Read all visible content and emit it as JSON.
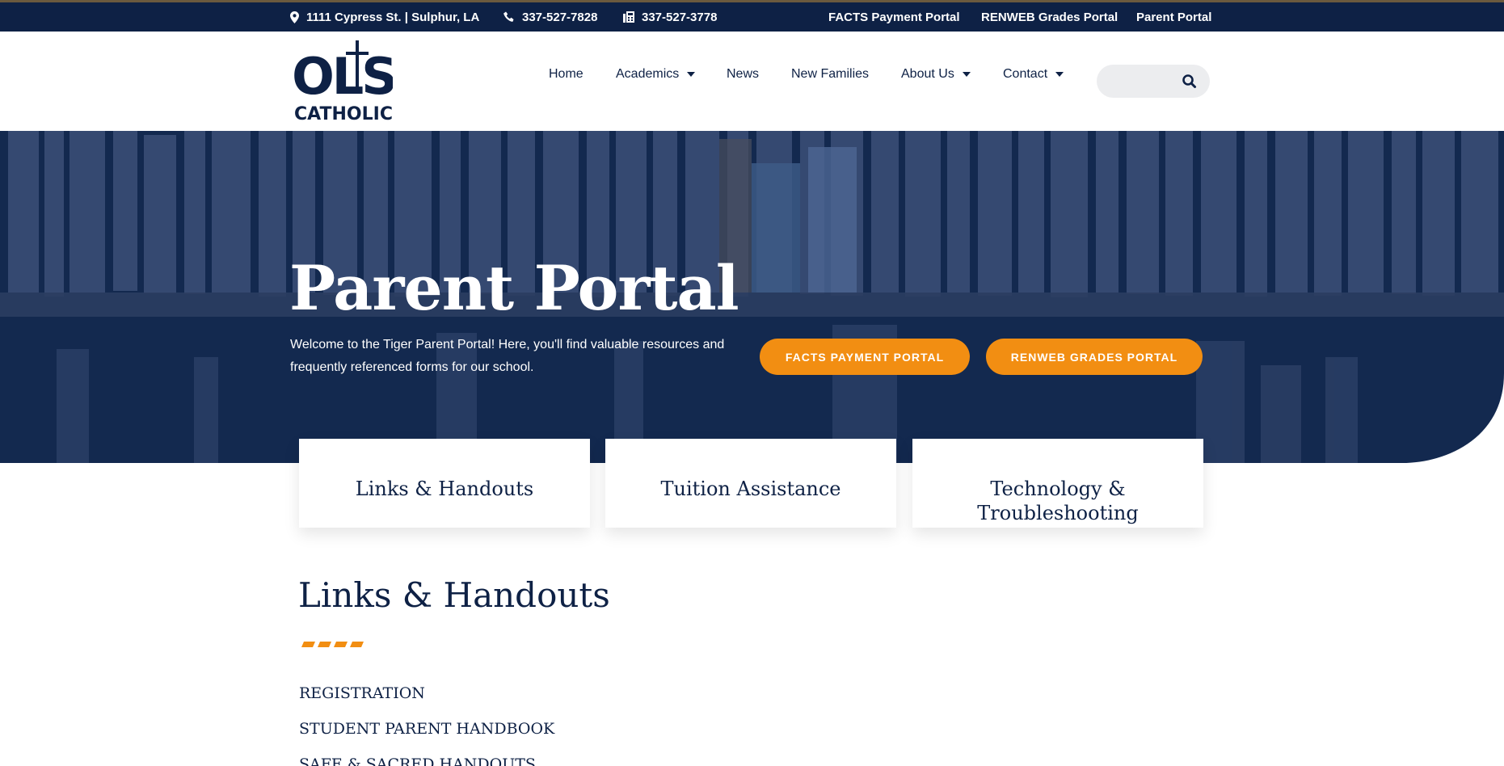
{
  "topbar": {
    "address": "1111 Cypress St. | Sulphur, LA",
    "phone": "337-527-7828",
    "fax": "337-527-3778",
    "links": [
      "FACTS Payment Portal",
      "RENWEB Grades Portal",
      "Parent Portal"
    ]
  },
  "logo": {
    "line1": "OLS",
    "line2": "CATHOLIC"
  },
  "nav": {
    "items": [
      "Home",
      "Academics",
      "News",
      "New Families",
      "About Us",
      "Contact"
    ]
  },
  "search": {
    "placeholder": ""
  },
  "hero": {
    "title": "Parent Portal",
    "desc_line1": "Welcome to the Tiger Parent Portal! Here, you'll find valuable resources and",
    "desc_line2": "frequently referenced forms for our school.",
    "button1": "FACTS PAYMENT PORTAL",
    "button2": "RENWEB GRADES PORTAL"
  },
  "cards": {
    "links": "Links & Handouts",
    "tuition": "Tuition Assistance",
    "tech_line1": "Technology &",
    "tech_line2": "Troubleshooting"
  },
  "section": {
    "title": "Links & Handouts",
    "items": [
      "REGISTRATION",
      "STUDENT PARENT HANDBOOK",
      "SAFE & SACRED HANDOUTS"
    ]
  },
  "colors": {
    "navy": "#0e2145",
    "orange": "#f28e12"
  }
}
